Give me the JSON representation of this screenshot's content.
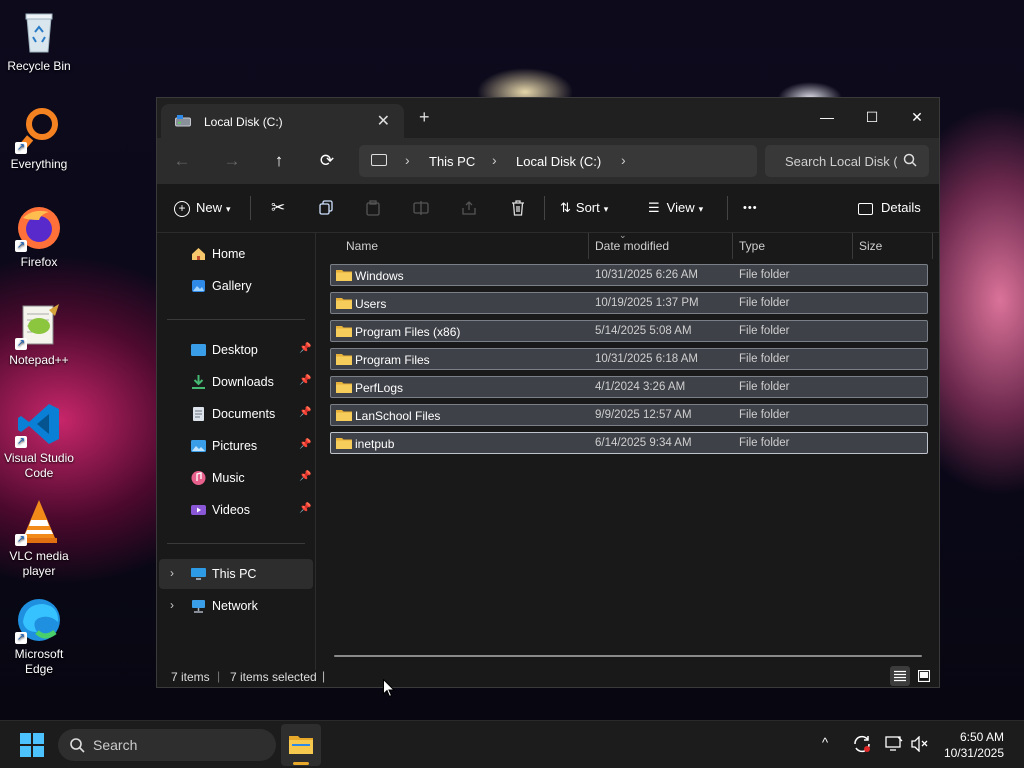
{
  "desktop": {
    "icons": [
      {
        "label": "Recycle Bin"
      },
      {
        "label": "Everything"
      },
      {
        "label": "Firefox"
      },
      {
        "label": "Notepad++"
      },
      {
        "label": "Visual Studio Code"
      },
      {
        "label": "VLC media player"
      },
      {
        "label": "Microsoft Edge"
      }
    ]
  },
  "window": {
    "tab_title": "Local Disk (C:)",
    "controls": {
      "minimize": "—",
      "maximize": "☐",
      "close": "✕"
    },
    "nav": {
      "back": "←",
      "forward": "→",
      "up": "↑",
      "refresh": "⟳"
    },
    "address": {
      "crumbs": [
        "This PC",
        "Local Disk (C:)"
      ],
      "separator": "›"
    },
    "search": {
      "placeholder": "Search Local Disk (C:)"
    },
    "commands": {
      "new": "New",
      "sort": "Sort",
      "view": "View",
      "more": "•••",
      "details": "Details"
    },
    "sidebar": {
      "home": "Home",
      "gallery": "Gallery",
      "quick_access": [
        {
          "label": "Desktop"
        },
        {
          "label": "Downloads"
        },
        {
          "label": "Documents"
        },
        {
          "label": "Pictures"
        },
        {
          "label": "Music"
        },
        {
          "label": "Videos"
        }
      ],
      "this_pc": "This PC",
      "network": "Network"
    },
    "columns": {
      "name": "Name",
      "date": "Date modified",
      "type": "Type",
      "size": "Size"
    },
    "files": [
      {
        "name": "Windows",
        "date": "10/31/2025 6:26 AM",
        "type": "File folder"
      },
      {
        "name": "Users",
        "date": "10/19/2025 1:37 PM",
        "type": "File folder"
      },
      {
        "name": "Program Files (x86)",
        "date": "5/14/2025 5:08 AM",
        "type": "File folder"
      },
      {
        "name": "Program Files",
        "date": "10/31/2025 6:18 AM",
        "type": "File folder"
      },
      {
        "name": "PerfLogs",
        "date": "4/1/2024 3:26 AM",
        "type": "File folder"
      },
      {
        "name": "LanSchool Files",
        "date": "9/9/2025 12:57 AM",
        "type": "File folder"
      },
      {
        "name": "inetpub",
        "date": "6/14/2025 9:34 AM",
        "type": "File folder"
      }
    ],
    "status": {
      "count": "7 items",
      "selected": "7 items selected",
      "sep": "|"
    }
  },
  "taskbar": {
    "search_placeholder": "Search",
    "time": "6:50 AM",
    "date": "10/31/2025",
    "tray_chevron": "^"
  },
  "colors": {
    "accent": "#0078d4",
    "folder": "#f0c24a",
    "selection": "#3e4147"
  }
}
